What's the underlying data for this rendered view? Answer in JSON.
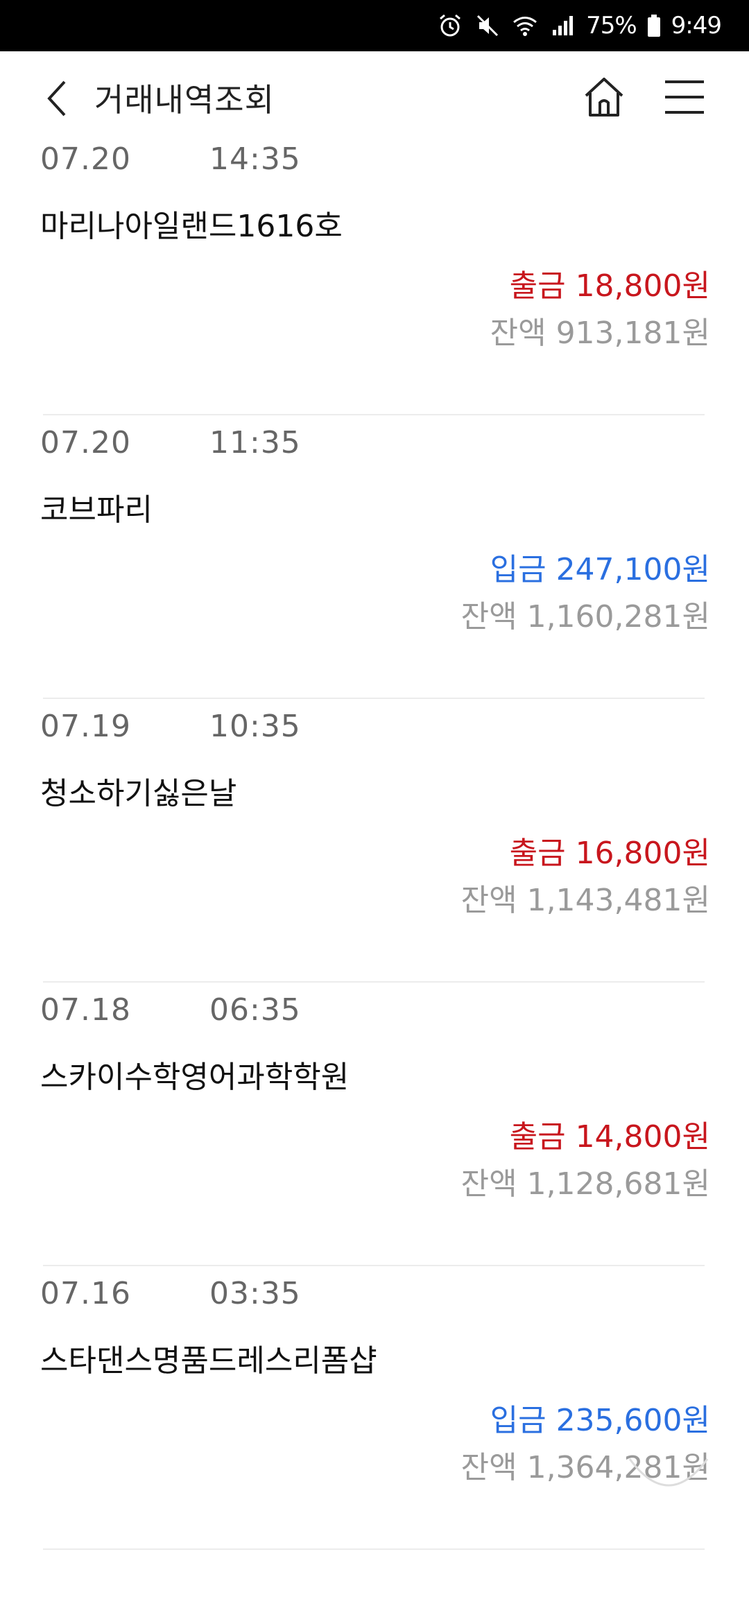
{
  "status_bar": {
    "battery": "75%",
    "time": "9:49",
    "icons": [
      "alarm-icon",
      "mute-icon",
      "wifi-icon",
      "signal-icon",
      "battery-icon"
    ]
  },
  "header": {
    "title": "거래내역조회",
    "icons": [
      "back-chevron-icon",
      "home-icon",
      "hamburger-menu-icon"
    ]
  },
  "colors": {
    "withdrawal": "#c8161d",
    "deposit": "#2a6fe0",
    "muted": "#9a9a9a"
  },
  "transactions": [
    {
      "date": "07.20",
      "time": "14:35",
      "description": "마리나아일랜드1616호",
      "type_label": "출금",
      "amount": "18,800원",
      "type": "withdrawal",
      "balance_label": "잔액",
      "balance": "913,181원"
    },
    {
      "date": "07.20",
      "time": "11:35",
      "description": "코브파리",
      "type_label": "입금",
      "amount": "247,100원",
      "type": "deposit",
      "balance_label": "잔액",
      "balance": "1,160,281원"
    },
    {
      "date": "07.19",
      "time": "10:35",
      "description": "청소하기싫은날",
      "type_label": "출금",
      "amount": "16,800원",
      "type": "withdrawal",
      "balance_label": "잔액",
      "balance": "1,143,481원"
    },
    {
      "date": "07.18",
      "time": "06:35",
      "description": "스카이수학영어과학학원",
      "type_label": "출금",
      "amount": "14,800원",
      "type": "withdrawal",
      "balance_label": "잔액",
      "balance": "1,128,681원"
    },
    {
      "date": "07.16",
      "time": "03:35",
      "description": "스타댄스명품드레스리폼샵",
      "type_label": "입금",
      "amount": "235,600원",
      "type": "deposit",
      "balance_label": "잔액",
      "balance": "1,364,281원"
    }
  ]
}
